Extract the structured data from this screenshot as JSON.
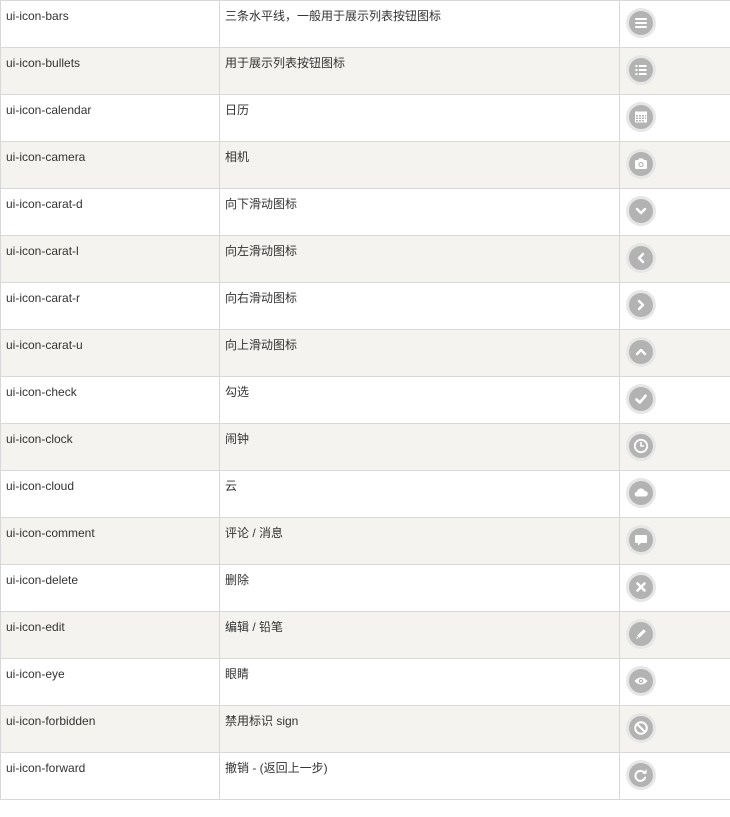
{
  "colors": {
    "row_alt": "#f4f3ef",
    "row_plain": "#ffffff",
    "border": "#d8d8d8",
    "icon_disc": "#b3b3b3",
    "icon_ring": "#e6e6e6",
    "text": "#333333"
  },
  "rows": [
    {
      "name": "ui-icon-bars",
      "desc": "三条水平线，一般用于展示列表按钮图标",
      "icon": "bars-icon"
    },
    {
      "name": "ui-icon-bullets",
      "desc": "用于展示列表按钮图标",
      "icon": "bullets-icon"
    },
    {
      "name": "ui-icon-calendar",
      "desc": "日历",
      "icon": "calendar-icon"
    },
    {
      "name": "ui-icon-camera",
      "desc": "相机",
      "icon": "camera-icon"
    },
    {
      "name": "ui-icon-carat-d",
      "desc": "向下滑动图标",
      "icon": "carat-down-icon"
    },
    {
      "name": "ui-icon-carat-l",
      "desc": "向左滑动图标",
      "icon": "carat-left-icon"
    },
    {
      "name": "ui-icon-carat-r",
      "desc": "向右滑动图标",
      "icon": "carat-right-icon"
    },
    {
      "name": "ui-icon-carat-u",
      "desc": "向上滑动图标",
      "icon": "carat-up-icon"
    },
    {
      "name": "ui-icon-check",
      "desc": "勾选",
      "icon": "check-icon"
    },
    {
      "name": "ui-icon-clock",
      "desc": "闹钟",
      "icon": "clock-icon"
    },
    {
      "name": "ui-icon-cloud",
      "desc": "云",
      "icon": "cloud-icon"
    },
    {
      "name": "ui-icon-comment",
      "desc": "评论 / 消息",
      "icon": "comment-icon"
    },
    {
      "name": "ui-icon-delete",
      "desc": "删除",
      "icon": "delete-icon"
    },
    {
      "name": "ui-icon-edit",
      "desc": "编辑 / 铅笔",
      "icon": "edit-icon"
    },
    {
      "name": "ui-icon-eye",
      "desc": "眼睛",
      "icon": "eye-icon"
    },
    {
      "name": "ui-icon-forbidden",
      "desc": "禁用标识 sign",
      "icon": "forbidden-icon"
    },
    {
      "name": "ui-icon-forward",
      "desc": "撤销 - (返回上一步)",
      "icon": "forward-icon"
    }
  ]
}
